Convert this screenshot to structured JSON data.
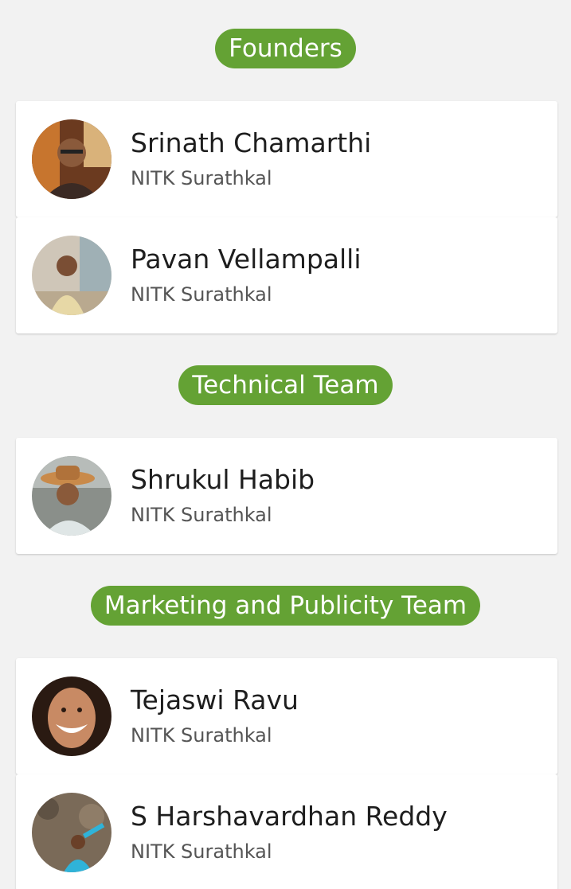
{
  "sections": [
    {
      "title": "Founders",
      "members": [
        {
          "name": "Srinath Chamarthi",
          "college": "NITK Surathkal",
          "photo": "avatar-photo"
        },
        {
          "name": "Pavan Vellampalli",
          "college": "NITK Surathkal",
          "photo": "avatar-photo"
        }
      ]
    },
    {
      "title": "Technical Team",
      "members": [
        {
          "name": "Shrukul Habib",
          "college": "NITK Surathkal",
          "photo": "avatar-photo"
        }
      ]
    },
    {
      "title": "Marketing and Publicity Team",
      "members": [
        {
          "name": "Tejaswi Ravu",
          "college": "NITK Surathkal",
          "photo": "avatar-photo"
        },
        {
          "name": "S Harshavardhan Reddy",
          "college": "NITK Surathkal",
          "photo": "avatar-photo"
        }
      ]
    }
  ],
  "colors": {
    "accent": "#64a234",
    "background": "#f2f2f2",
    "card": "#ffffff",
    "name_text": "#1e1e1e",
    "college_text": "#555555"
  }
}
